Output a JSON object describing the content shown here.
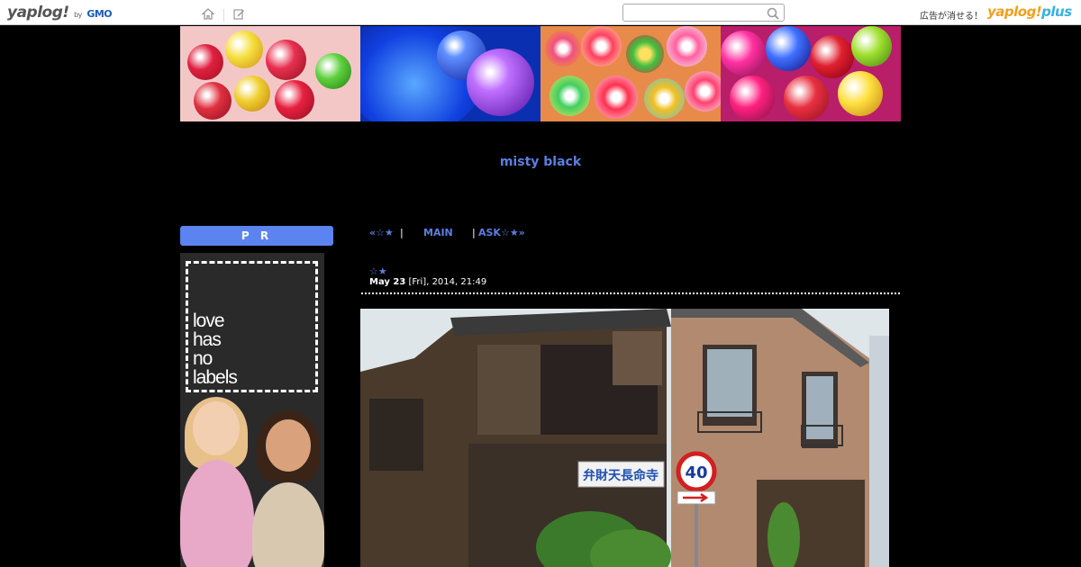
{
  "topbar": {
    "logo_main": "yaplog!",
    "logo_by": "by",
    "logo_gmo": "GMO",
    "search_placeholder": "",
    "ad_remove_text": "広告が消せる！",
    "plus_logo_a": "yaplog!",
    "plus_logo_b": "plus"
  },
  "site": {
    "title": "misty black"
  },
  "sidebar": {
    "pr_label": "P R",
    "ad_lines": [
      "love",
      "has",
      "no",
      "labels"
    ]
  },
  "nav": {
    "prev": "«☆★",
    "sep1": "|",
    "main": "MAIN",
    "sep2": "|",
    "next": "ASK☆★»"
  },
  "entry": {
    "title": "☆★",
    "date_bold": "May 23",
    "date_rest": " [Fri], 2014, 21:49"
  },
  "photo": {
    "sign_text": "弁財天長命寺",
    "speed_limit": "40"
  },
  "colors": {
    "accent": "#5b7fe0",
    "pr_bg": "#5b84f0",
    "background": "#000000"
  }
}
